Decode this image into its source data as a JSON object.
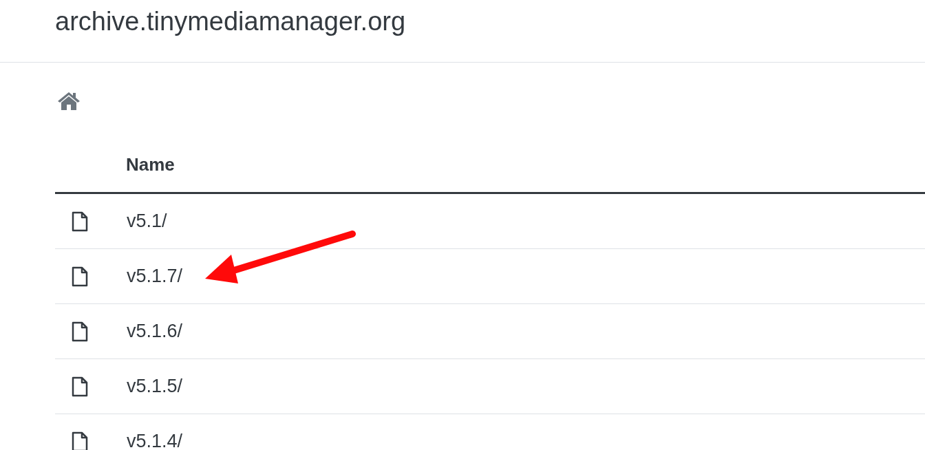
{
  "header": {
    "title": "archive.tinymediamanager.org"
  },
  "breadcrumb": {
    "kind": "home"
  },
  "table": {
    "columns": [
      "Name"
    ],
    "rows": [
      {
        "name": "v5.1/"
      },
      {
        "name": "v5.1.7/"
      },
      {
        "name": "v5.1.6/"
      },
      {
        "name": "v5.1.5/"
      },
      {
        "name": "v5.1.4/"
      }
    ]
  }
}
